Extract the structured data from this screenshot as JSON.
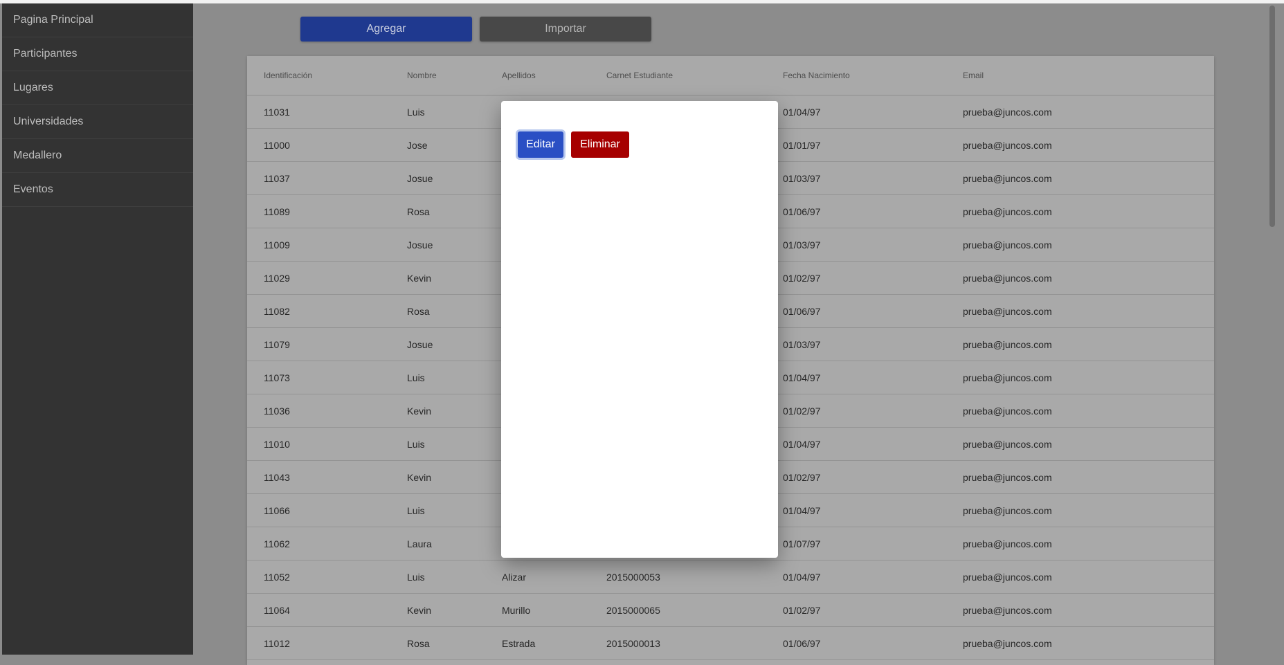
{
  "sidebar": {
    "items": [
      {
        "label": "Pagina Principal"
      },
      {
        "label": "Participantes"
      },
      {
        "label": "Lugares"
      },
      {
        "label": "Universidades"
      },
      {
        "label": "Medallero"
      },
      {
        "label": "Eventos"
      }
    ]
  },
  "toolbar": {
    "add_label": "Agregar",
    "import_label": "Importar"
  },
  "table": {
    "headers": [
      "Identificación",
      "Nombre",
      "Apellidos",
      "Carnet Estudiante",
      "Fecha Nacimiento",
      "Email"
    ],
    "rows": [
      [
        "11031",
        "Luis",
        "",
        "",
        "01/04/97",
        "prueba@juncos.com"
      ],
      [
        "11000",
        "Jose",
        "",
        "",
        "01/01/97",
        "prueba@juncos.com"
      ],
      [
        "11037",
        "Josue",
        "",
        "",
        "01/03/97",
        "prueba@juncos.com"
      ],
      [
        "11089",
        "Rosa",
        "",
        "",
        "01/06/97",
        "prueba@juncos.com"
      ],
      [
        "11009",
        "Josue",
        "",
        "",
        "01/03/97",
        "prueba@juncos.com"
      ],
      [
        "11029",
        "Kevin",
        "",
        "",
        "01/02/97",
        "prueba@juncos.com"
      ],
      [
        "11082",
        "Rosa",
        "",
        "",
        "01/06/97",
        "prueba@juncos.com"
      ],
      [
        "11079",
        "Josue",
        "",
        "",
        "01/03/97",
        "prueba@juncos.com"
      ],
      [
        "11073",
        "Luis",
        "",
        "",
        "01/04/97",
        "prueba@juncos.com"
      ],
      [
        "11036",
        "Kevin",
        "",
        "",
        "01/02/97",
        "prueba@juncos.com"
      ],
      [
        "11010",
        "Luis",
        "",
        "",
        "01/04/97",
        "prueba@juncos.com"
      ],
      [
        "11043",
        "Kevin",
        "",
        "",
        "01/02/97",
        "prueba@juncos.com"
      ],
      [
        "11066",
        "Luis",
        "",
        "",
        "01/04/97",
        "prueba@juncos.com"
      ],
      [
        "11062",
        "Laura",
        "",
        "",
        "01/07/97",
        "prueba@juncos.com"
      ],
      [
        "11052",
        "Luis",
        "Alizar",
        "2015000053",
        "01/04/97",
        "prueba@juncos.com"
      ],
      [
        "11064",
        "Kevin",
        "Murillo",
        "2015000065",
        "01/02/97",
        "prueba@juncos.com"
      ],
      [
        "11012",
        "Rosa",
        "Estrada",
        "2015000013",
        "01/06/97",
        "prueba@juncos.com"
      ]
    ]
  },
  "modal": {
    "edit_label": "Editar",
    "delete_label": "Eliminar"
  }
}
